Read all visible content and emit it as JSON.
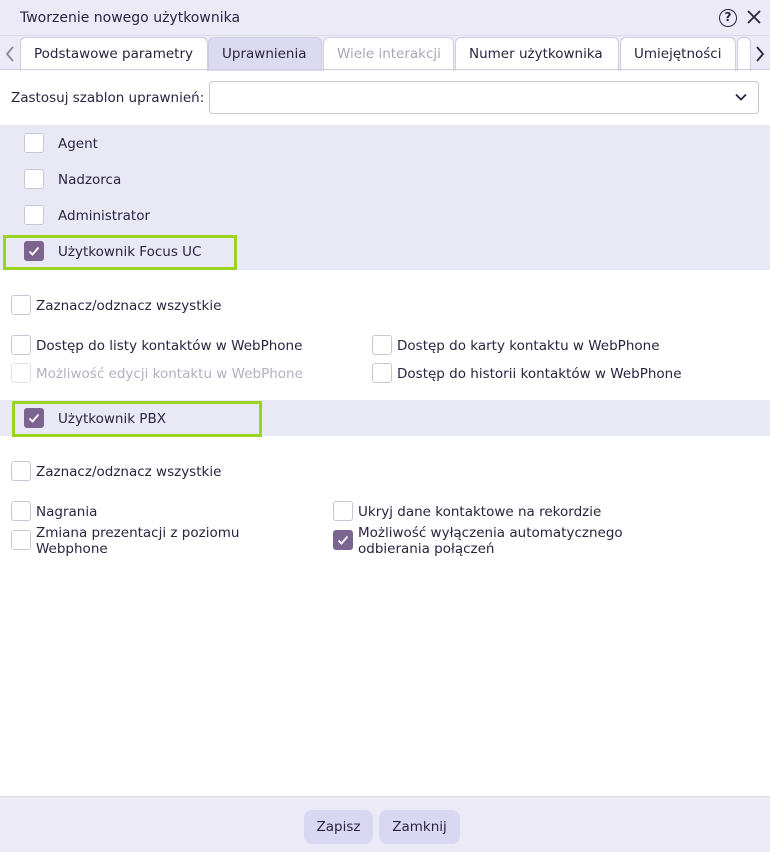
{
  "window": {
    "title": "Tworzenie nowego użytkownika"
  },
  "tabs": [
    {
      "label": "Podstawowe parametry",
      "state": "normal"
    },
    {
      "label": "Uprawnienia",
      "state": "selected"
    },
    {
      "label": "Wiele interakcji",
      "state": "disabled"
    },
    {
      "label": "Numer użytkownika",
      "state": "normal"
    },
    {
      "label": "Umiejętności",
      "state": "normal"
    }
  ],
  "template": {
    "label": "Zastosuj szablon uprawnień:",
    "value": ""
  },
  "roles": [
    {
      "label": "Agent",
      "checked": false
    },
    {
      "label": "Nadzorca",
      "checked": false
    },
    {
      "label": "Administrator",
      "checked": false
    },
    {
      "label": "Użytkownik Focus UC",
      "checked": true
    }
  ],
  "focus_uc": {
    "select_all": "Zaznacz/odznacz wszystkie",
    "options": [
      {
        "label": "Dostęp do listy kontaktów w WebPhone",
        "checked": false,
        "disabled": false
      },
      {
        "label": "Dostęp do karty kontaktu w WebPhone",
        "checked": false,
        "disabled": false
      },
      {
        "label": "Możliwość edycji kontaktu w WebPhone",
        "checked": false,
        "disabled": true
      },
      {
        "label": "Dostęp do historii kontaktów w WebPhone",
        "checked": false,
        "disabled": false
      }
    ]
  },
  "pbx": {
    "label": "Użytkownik PBX",
    "checked": true,
    "select_all": "Zaznacz/odznacz wszystkie",
    "options": [
      {
        "label": "Nagrania",
        "checked": false
      },
      {
        "label": "Ukryj dane kontaktowe na rekordzie",
        "checked": false
      },
      {
        "label": "Zmiana prezentacji z poziomu Webphone",
        "checked": false
      },
      {
        "label": "Możliwość wyłączenia automatycznego odbierania połączeń",
        "checked": true
      }
    ]
  },
  "footer": {
    "save_label": "Zapisz",
    "close_label": "Zamknij"
  },
  "colors": {
    "accent": "#7b6590",
    "highlight": "#9ad320",
    "band": "#e9e8f5"
  }
}
